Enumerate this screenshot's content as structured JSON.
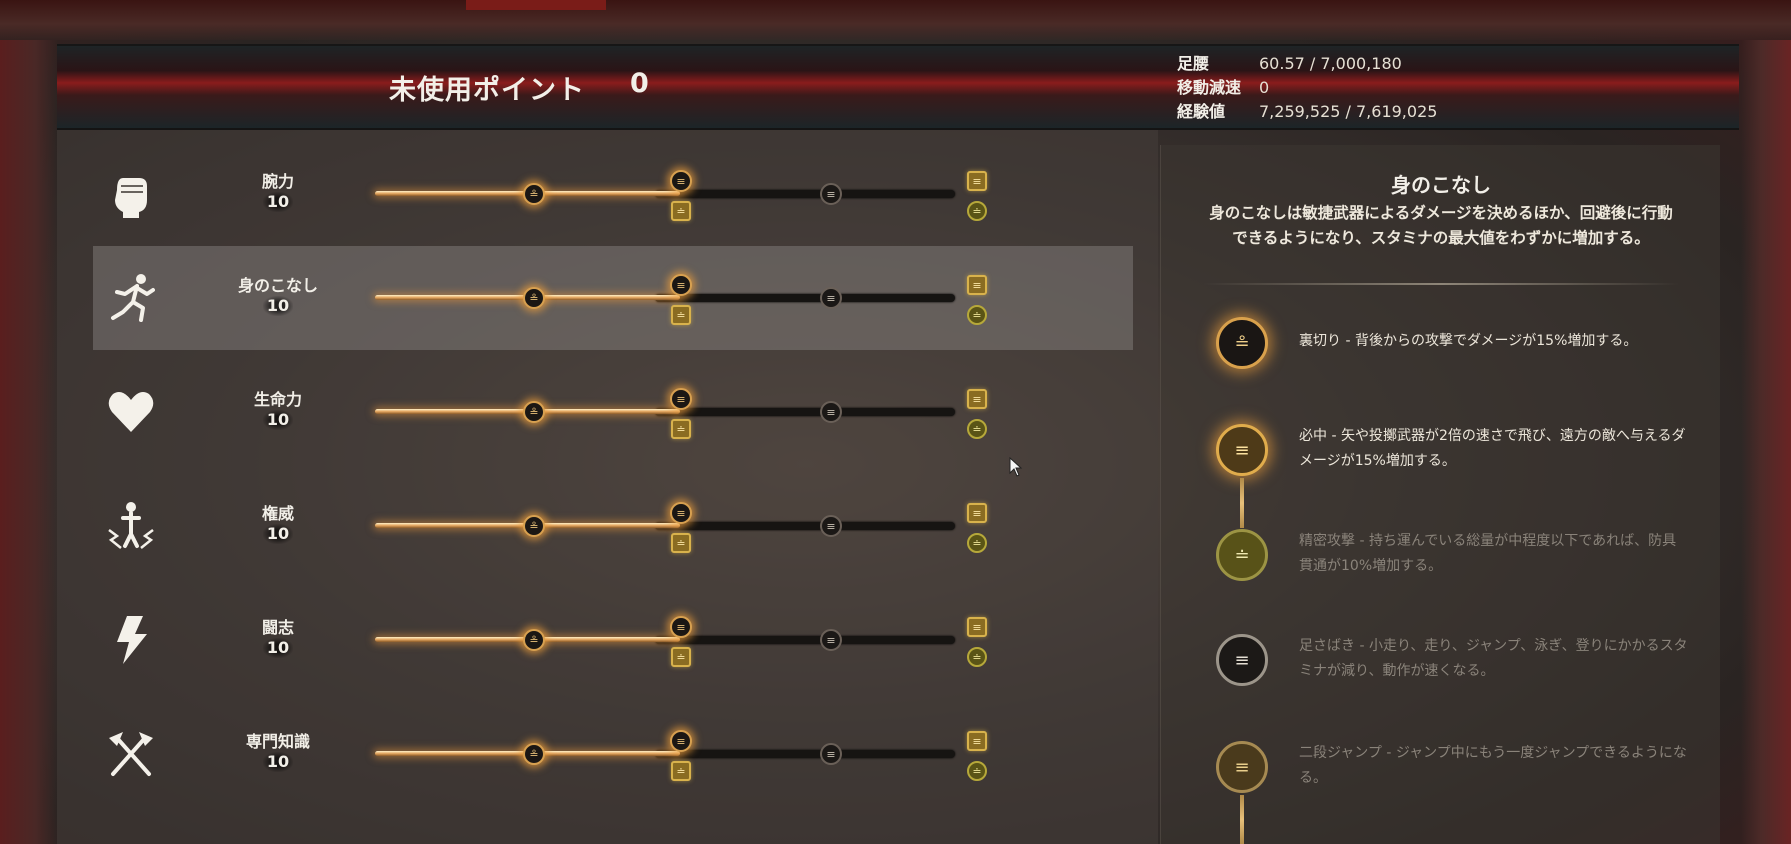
{
  "header": {
    "points_label": "未使用ポイント",
    "points_value": "0",
    "stats": [
      {
        "key": "足腰",
        "value": "60.57 / 7,000,180"
      },
      {
        "key": "移動減速",
        "value": "0"
      },
      {
        "key": "経験値",
        "value": "7,259,525 / 7,619,025"
      }
    ]
  },
  "attributes": [
    {
      "name": "腕力",
      "value": "10",
      "icon": "fist-icon"
    },
    {
      "name": "身のこなし",
      "value": "10",
      "icon": "running-figure-icon",
      "selected": true
    },
    {
      "name": "生命力",
      "value": "10",
      "icon": "heart-icon"
    },
    {
      "name": "権威",
      "value": "10",
      "icon": "figure-lightning-icon"
    },
    {
      "name": "闘志",
      "value": "10",
      "icon": "lightning-bolt-icon"
    },
    {
      "name": "専門知識",
      "value": "10",
      "icon": "crossed-tools-icon"
    }
  ],
  "detail": {
    "title": "身のこなし",
    "description": "身のこなしは敏捷武器によるダメージを決めるほか、回避後に行動できるようになり、スタミナの最大値をわずかに増加する。",
    "perks": [
      {
        "text": "裏切り - 背後からの攻撃でダメージが15%増加する。",
        "state": "unlocked"
      },
      {
        "text": "必中 - 矢や投擲武器が2倍の速さで飛び、遠方の敵へ与えるダメージが15%増加する。",
        "state": "unlocked"
      },
      {
        "text": "精密攻撃 - 持ち運んでいる総量が中程度以下であれば、防具貫通が10%増加する。",
        "state": "locked"
      },
      {
        "text": "足さばき - 小走り、走り、ジャンプ、泳ぎ、登りにかかるスタミナが減り、動作が速くなる。",
        "state": "locked"
      },
      {
        "text": "二段ジャンプ - ジャンプ中にもう一度ジャンプできるようになる。",
        "state": "locked"
      }
    ]
  },
  "colors": {
    "accent_gold": "#d9a14c",
    "header_red": "#8a1c1c",
    "perk_olive": "#585218"
  }
}
